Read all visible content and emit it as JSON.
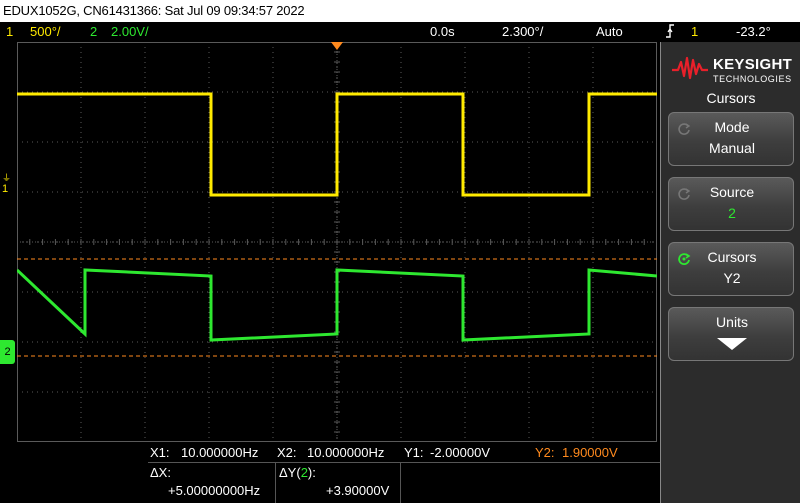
{
  "title_bar": {
    "text": "EDUX1052G, CN61431366: Sat Jul 09 09:34:57 2022"
  },
  "status_bar": {
    "ch1_num": "1",
    "ch1_scale": "500°/",
    "ch2_num": "2",
    "ch2_scale": "2.00V/",
    "time_delay": "0.0s",
    "time_scale": "2.300°/",
    "trigger_mode": "Auto",
    "trigger_source_icon": "trigger-edge-icon",
    "trigger_source": "1",
    "trigger_level": "-23.2°"
  },
  "markers": {
    "ch1": "1",
    "ch1_ground": "⏚",
    "ch2": "2"
  },
  "readout": {
    "x1_label": "X1:",
    "x1_value": "10.000000Hz",
    "x2_label": "X2:",
    "x2_value": "10.000000Hz",
    "y1_label": "Y1:",
    "y1_value": "-2.00000V",
    "y2_label": "Y2:",
    "y2_value": "1.90000V",
    "dx_label": "ΔX:",
    "dx_value": "+5.00000000Hz",
    "dy_label_prefix": "ΔY(",
    "dy_label_ch": "2",
    "dy_label_suffix": "):",
    "dy_value": "+3.90000V"
  },
  "panel": {
    "brand": "KEYSIGHT",
    "brand_sub": "TECHNOLOGIES",
    "menu_title": "Cursors",
    "softkeys": [
      {
        "label": "Mode",
        "value": "Manual"
      },
      {
        "label": "Source",
        "value": "2"
      },
      {
        "label": "Cursors",
        "value": "Y2"
      },
      {
        "label": "Units",
        "value": ""
      }
    ]
  },
  "colors": {
    "ch1": "#ffea00",
    "ch2": "#2ee830",
    "cursor": "#ff8a1e",
    "grid": "#5a5a5a"
  }
}
